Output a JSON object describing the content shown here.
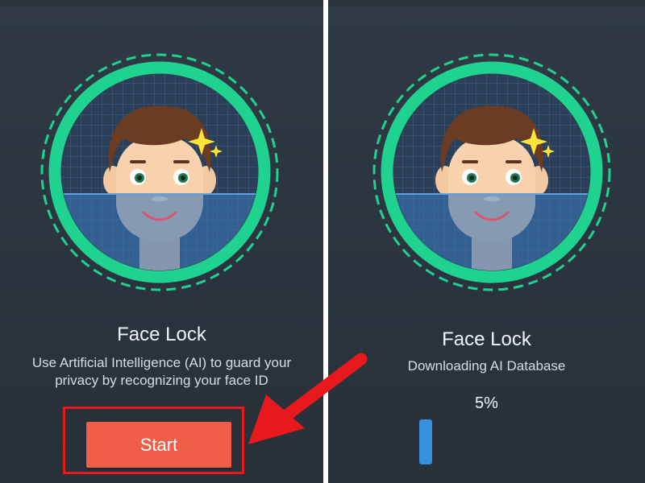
{
  "left_panel": {
    "title": "Face Lock",
    "description": "Use Artificial Intelligence (AI) to guard your privacy by recognizing your face ID",
    "start_label": "Start"
  },
  "right_panel": {
    "title": "Face Lock",
    "status": "Downloading AI Database",
    "progress_text": "5%",
    "progress_value": 0.05
  },
  "colors": {
    "background": "#2f3a44",
    "ring": "#1fd28f",
    "start_button": "#ef5f48",
    "annotation_red": "#e8191c",
    "progress_blue": "#3a8ee0"
  },
  "icons": [
    "face-scan-illustration",
    "sparkle-icon",
    "arrow-annotation"
  ]
}
